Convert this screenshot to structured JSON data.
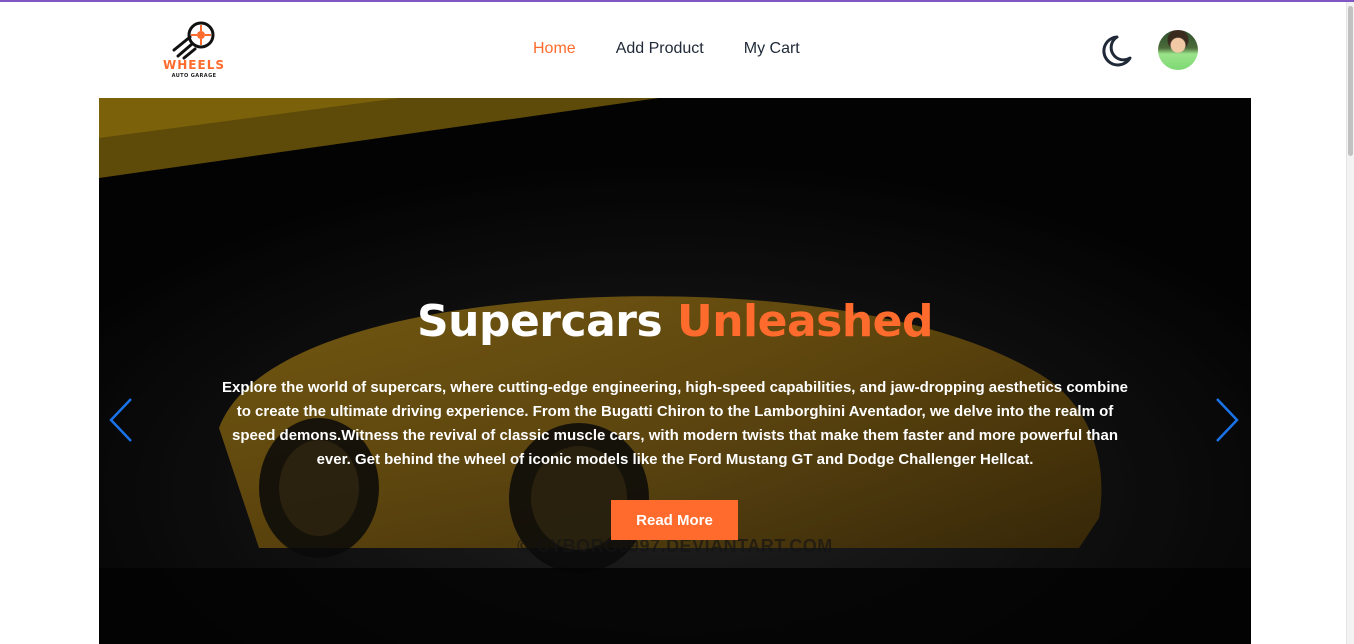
{
  "header": {
    "logo": {
      "name": "WHEELS",
      "tagline": "AUTO GARAGE",
      "icon": "wheel-icon"
    },
    "nav": [
      {
        "label": "Home",
        "active": true
      },
      {
        "label": "Add Product",
        "active": false
      },
      {
        "label": "My Cart",
        "active": false
      }
    ],
    "theme_toggle_icon": "moon-icon",
    "avatar_icon": "user-avatar"
  },
  "hero": {
    "title_main": "Supercars",
    "title_accent": "Unleashed",
    "description": "Explore the world of supercars, where cutting-edge engineering, high-speed capabilities, and jaw-dropping aesthetics combine to create the ultimate driving experience. From the Bugatti Chiron to the Lamborghini Aventador, we delve into the realm of speed demons.Witness the revival of classic muscle cars, with modern twists that make them faster and more powerful than ever. Get behind the wheel of iconic models like the Ford Mustang GT and Dodge Challenger Hellcat.",
    "button_label": "Read More",
    "watermark": "© CYBORG8997.DEVIANTART.COM",
    "prev_icon": "chevron-left-icon",
    "next_icon": "chevron-right-icon"
  },
  "colors": {
    "accent": "#ff6b2c",
    "top_stripe": "#7e57c2",
    "nav_text": "#1f2937",
    "carousel_arrow": "#1a73e8"
  }
}
